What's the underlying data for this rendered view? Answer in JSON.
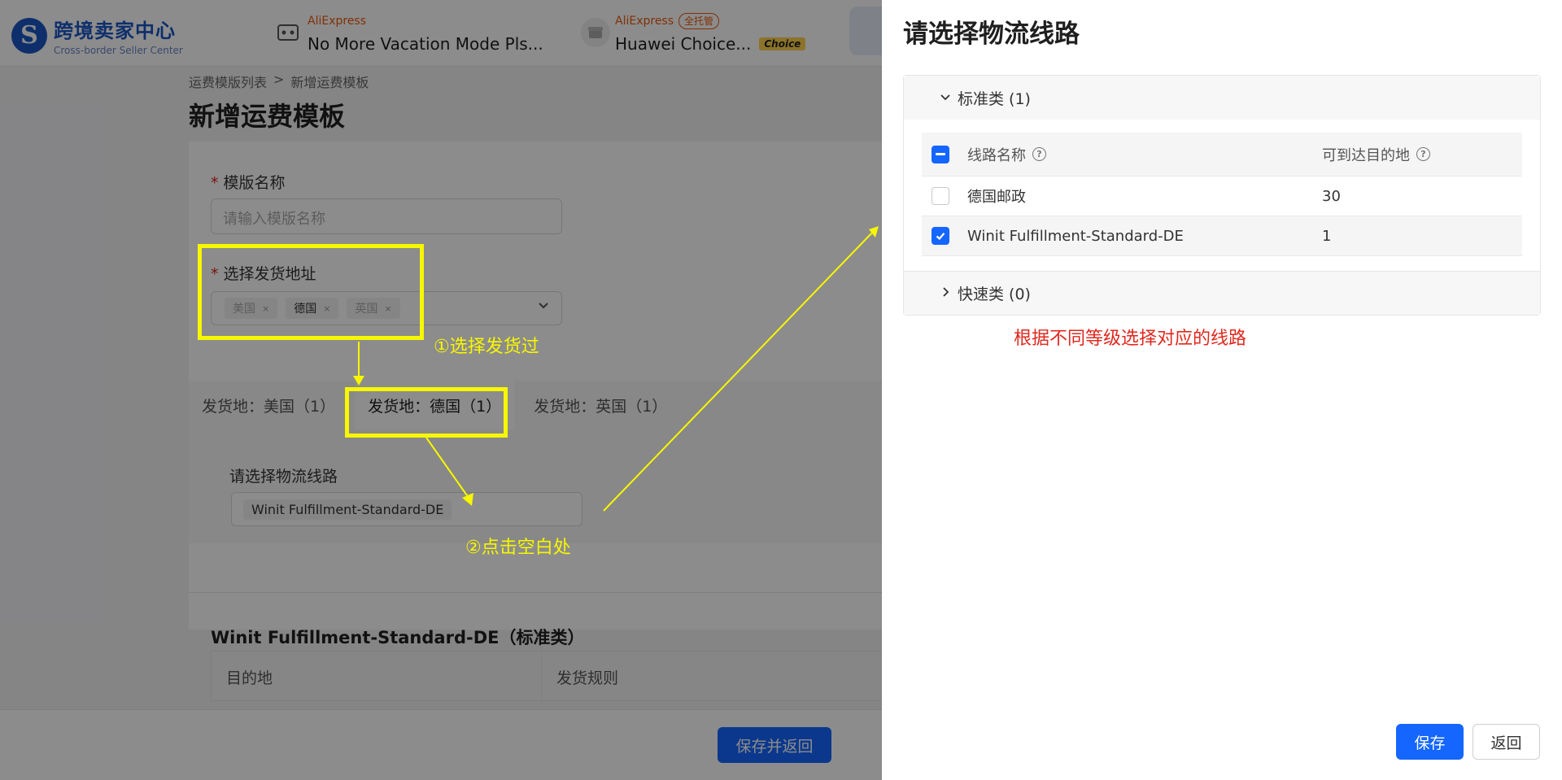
{
  "header": {
    "logo_title": "跨境卖家中心",
    "logo_sub": "Cross-border Seller Center",
    "stores": [
      {
        "brand": "AliExpress",
        "name": "No More Vacation Mode Pls...",
        "badge": "",
        "choice": ""
      },
      {
        "brand": "AliExpress",
        "name": "Huawei Choice...",
        "badge": "全托管",
        "choice": "Choice"
      }
    ]
  },
  "breadcrumb": {
    "parent": "运费模版列表",
    "separator": ">",
    "current": "新增运费模板"
  },
  "page_title": "新增运费模板",
  "form": {
    "name_label": "模版名称",
    "name_placeholder": "请输入模版名称",
    "address_label": "选择发货地址",
    "address_tags": [
      "美国",
      "德国",
      "英国"
    ],
    "required_mark": "*"
  },
  "tabs": [
    "发货地：美国（1）",
    "发货地：德国（1）",
    "发货地：英国（1）"
  ],
  "route_section": {
    "label": "请选择物流线路",
    "selected_tag": "Winit Fulfillment-Standard-DE"
  },
  "template_section": {
    "title": "Winit Fulfillment-Standard-DE（标准类）",
    "columns": [
      "目的地",
      "发货规则"
    ]
  },
  "bottom": {
    "save_return": "保存并返回"
  },
  "annotations": {
    "step1": "①选择发货过",
    "step2": "②点击空白处",
    "note": "根据不同等级选择对应的线路"
  },
  "drawer": {
    "title": "请选择物流线路",
    "standard_panel": "标准类 (1)",
    "express_panel": "快速类 (0)",
    "table_headers": {
      "name": "线路名称",
      "dest": "可到达目的地"
    },
    "rows": [
      {
        "name": "德国邮政",
        "dest": "30",
        "checked": false
      },
      {
        "name": "Winit Fulfillment-Standard-DE",
        "dest": "1",
        "checked": true
      }
    ],
    "save": "保存",
    "back": "返回"
  },
  "icons": {
    "logo": "logo-s-icon",
    "store1": "store-avatar-icon",
    "store2": "shop-cart-icon",
    "help": "question-circle-icon",
    "chevron_down": "chevron-down-icon",
    "chevron_right": "chevron-right-icon",
    "check": "check-icon",
    "indeterminate": "indeterminate-icon"
  },
  "colors": {
    "primary": "#1466ff",
    "annotation_yellow": "#f7f700",
    "note_red": "#e0281e",
    "aliexpress_orange": "#e8590c",
    "brand_blue": "#1a56c4"
  }
}
